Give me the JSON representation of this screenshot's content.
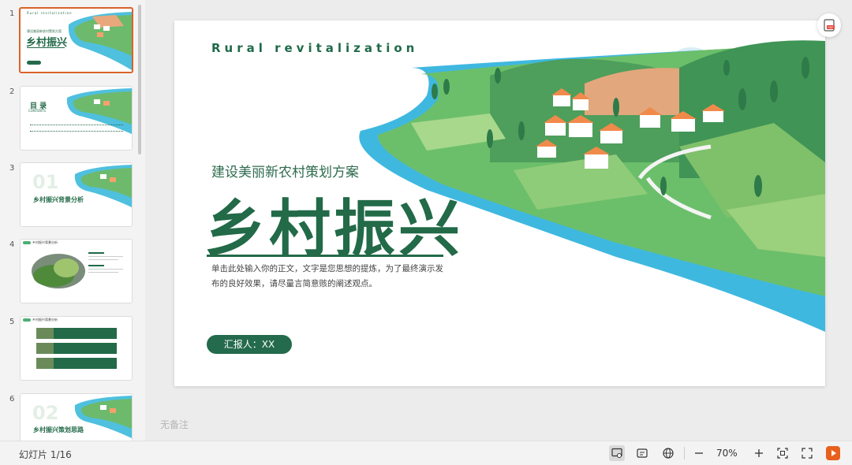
{
  "thumbnails": [
    {
      "num": "1",
      "title": "乡村振兴",
      "kind": "cover"
    },
    {
      "num": "2",
      "title": "目 录",
      "sub": "CONTENTS",
      "kind": "toc"
    },
    {
      "num": "3",
      "big": "01",
      "title": "乡村振兴背景分析",
      "kind": "section"
    },
    {
      "num": "4",
      "title": "乡村振兴背景分析",
      "kind": "image"
    },
    {
      "num": "5",
      "title": "乡村振兴背景分析",
      "kind": "list"
    },
    {
      "num": "6",
      "big": "02",
      "title": "乡村振兴策划思路",
      "kind": "section"
    }
  ],
  "slide": {
    "eyebrow": "Rural revitalization",
    "subtitle": "建设美丽新农村策划方案",
    "title": "乡村振兴",
    "body": "单击此处输入你的正文，文字是您思想的提炼，为了最终演示发布的良好效果，请尽量言简意赅的阐述观点。",
    "reporter": "汇报人：XX"
  },
  "notes_placeholder": "无备注",
  "status": {
    "slide_indicator": "幻灯片 1/16",
    "zoom": "70%"
  },
  "colors": {
    "accent": "#226a48",
    "active_border": "#d9632a",
    "play": "#e8601c"
  },
  "icons": [
    "pdf-export-icon",
    "notes-view-icon",
    "comment-icon",
    "globe-icon",
    "zoom-out-icon",
    "zoom-in-icon",
    "fit-icon",
    "fullscreen-icon",
    "play-icon"
  ]
}
